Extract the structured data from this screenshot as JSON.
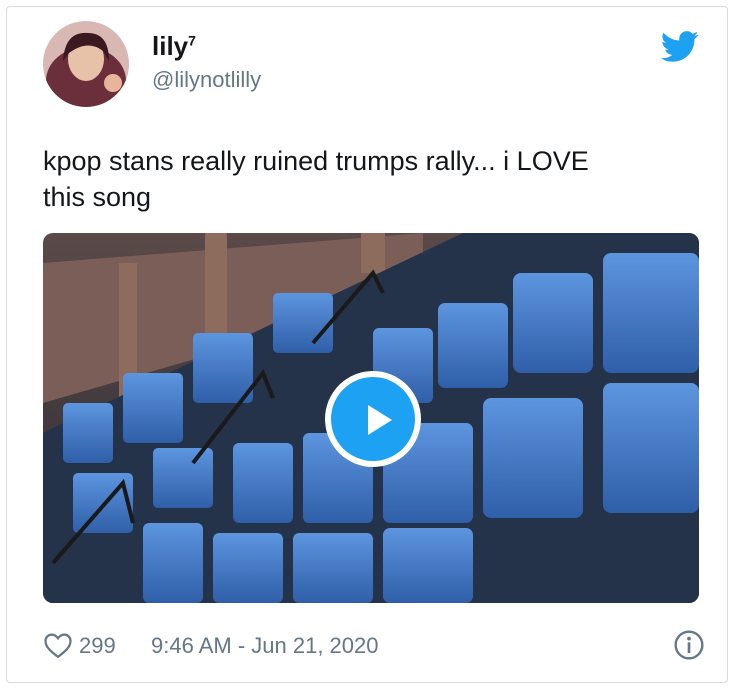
{
  "tweet": {
    "display_name": "lily",
    "name_superscript": "7",
    "handle": "@lilynotlilly",
    "text_line1": "kpop stans really ruined trumps rally... i LOVE",
    "text_line2": "this song",
    "likes": "299",
    "timestamp": "9:46 AM - Jun 21, 2020"
  },
  "icons": {
    "brand": "twitter-bird-icon",
    "play": "play-icon",
    "like": "heart-icon",
    "info": "info-icon"
  },
  "colors": {
    "accent": "#1da1f2",
    "text": "#14171a",
    "muted": "#657786",
    "seat_blue": "#3f78c8"
  }
}
